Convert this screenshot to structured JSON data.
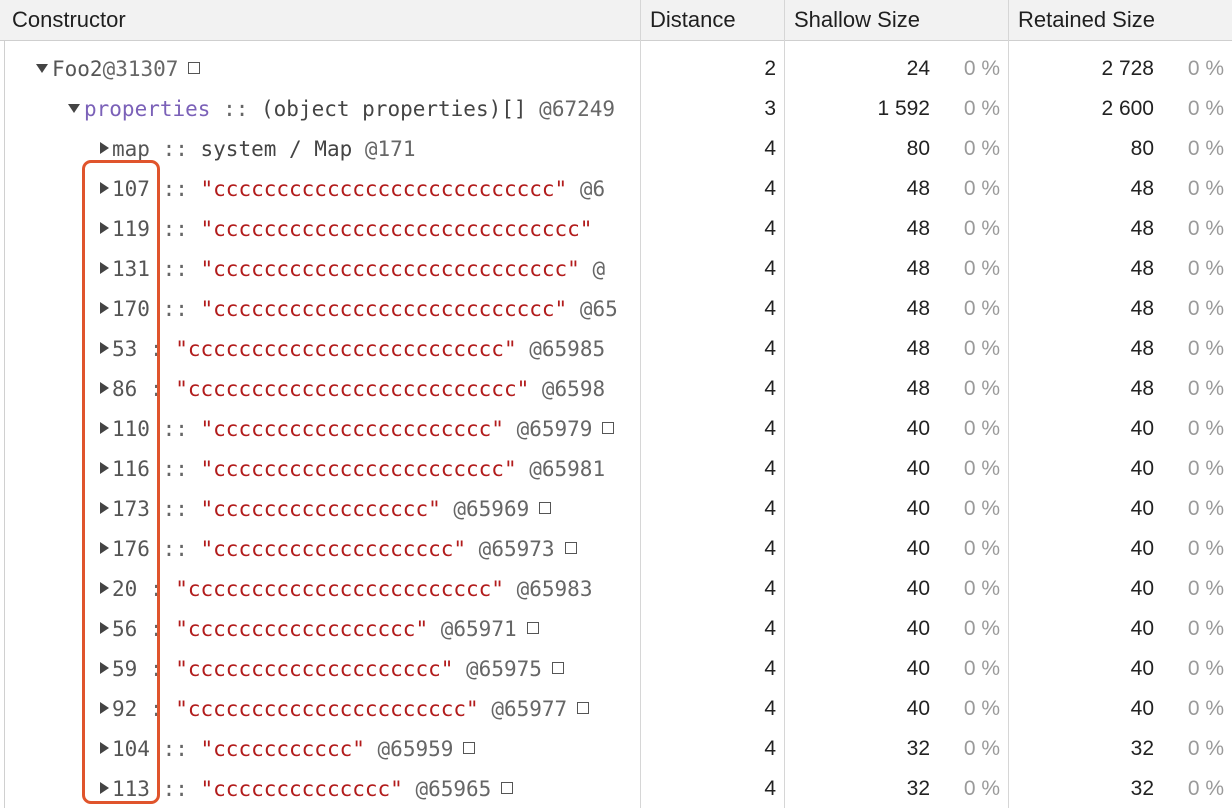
{
  "columns": {
    "constructor": "Constructor",
    "distance": "Distance",
    "shallow": "Shallow Size",
    "retained": "Retained Size"
  },
  "colors": {
    "string": "#b21b1b",
    "highlight": "#e0542c",
    "header_bg": "#f2f2f2"
  },
  "rows": [
    {
      "level": 0,
      "expanded": true,
      "key": "Foo2",
      "sep": "",
      "str": "",
      "type": "",
      "id": "@31307",
      "box": true,
      "distance": "2",
      "shallow": "24",
      "shallow_pct": "0 %",
      "retained": "2 728",
      "retained_pct": "0 %"
    },
    {
      "level": 1,
      "expanded": true,
      "key": "properties",
      "sep": " :: ",
      "str": "",
      "type": "(object properties)[] ",
      "id": "@67249",
      "box": false,
      "distance": "3",
      "shallow": "1 592",
      "shallow_pct": "0 %",
      "retained": "2 600",
      "retained_pct": "0 %"
    },
    {
      "level": 2,
      "expanded": false,
      "key": "map",
      "sep": " :: ",
      "str": "",
      "type": "system / Map ",
      "id": "@171",
      "box": false,
      "distance": "4",
      "shallow": "80",
      "shallow_pct": "0 %",
      "retained": "80",
      "retained_pct": "0 %"
    },
    {
      "level": 2,
      "expanded": false,
      "key": "107",
      "sep": " :: ",
      "str": "\"ccccccccccccccccccccccccccc\"",
      "type": "",
      "id": " @6",
      "box": false,
      "distance": "4",
      "shallow": "48",
      "shallow_pct": "0 %",
      "retained": "48",
      "retained_pct": "0 %"
    },
    {
      "level": 2,
      "expanded": false,
      "key": "119",
      "sep": " :: ",
      "str": "\"ccccccccccccccccccccccccccccc\"",
      "type": "",
      "id": "",
      "box": false,
      "distance": "4",
      "shallow": "48",
      "shallow_pct": "0 %",
      "retained": "48",
      "retained_pct": "0 %"
    },
    {
      "level": 2,
      "expanded": false,
      "key": "131",
      "sep": " :: ",
      "str": "\"cccccccccccccccccccccccccccc\"",
      "type": "",
      "id": " @",
      "box": false,
      "distance": "4",
      "shallow": "48",
      "shallow_pct": "0 %",
      "retained": "48",
      "retained_pct": "0 %"
    },
    {
      "level": 2,
      "expanded": false,
      "key": "170",
      "sep": " :: ",
      "str": "\"ccccccccccccccccccccccccccc\"",
      "type": "",
      "id": " @65",
      "box": false,
      "distance": "4",
      "shallow": "48",
      "shallow_pct": "0 %",
      "retained": "48",
      "retained_pct": "0 %"
    },
    {
      "level": 2,
      "expanded": false,
      "key": "53",
      "sep": "  : ",
      "str": "\"ccccccccccccccccccccccccc\"",
      "type": "",
      "id": " @65985",
      "box": false,
      "distance": "4",
      "shallow": "48",
      "shallow_pct": "0 %",
      "retained": "48",
      "retained_pct": "0 %"
    },
    {
      "level": 2,
      "expanded": false,
      "key": "86",
      "sep": "  : ",
      "str": "\"cccccccccccccccccccccccccc\"",
      "type": "",
      "id": " @6598",
      "box": false,
      "distance": "4",
      "shallow": "48",
      "shallow_pct": "0 %",
      "retained": "48",
      "retained_pct": "0 %"
    },
    {
      "level": 2,
      "expanded": false,
      "key": "110",
      "sep": " :: ",
      "str": "\"cccccccccccccccccccccc\"",
      "type": "",
      "id": " @65979",
      "box": true,
      "distance": "4",
      "shallow": "40",
      "shallow_pct": "0 %",
      "retained": "40",
      "retained_pct": "0 %"
    },
    {
      "level": 2,
      "expanded": false,
      "key": "116",
      "sep": " :: ",
      "str": "\"ccccccccccccccccccccccc\"",
      "type": "",
      "id": " @65981",
      "box": false,
      "distance": "4",
      "shallow": "40",
      "shallow_pct": "0 %",
      "retained": "40",
      "retained_pct": "0 %"
    },
    {
      "level": 2,
      "expanded": false,
      "key": "173",
      "sep": " :: ",
      "str": "\"ccccccccccccccccc\"",
      "type": "",
      "id": " @65969",
      "box": true,
      "distance": "4",
      "shallow": "40",
      "shallow_pct": "0 %",
      "retained": "40",
      "retained_pct": "0 %"
    },
    {
      "level": 2,
      "expanded": false,
      "key": "176",
      "sep": " :: ",
      "str": "\"ccccccccccccccccccc\"",
      "type": "",
      "id": " @65973",
      "box": true,
      "distance": "4",
      "shallow": "40",
      "shallow_pct": "0 %",
      "retained": "40",
      "retained_pct": "0 %"
    },
    {
      "level": 2,
      "expanded": false,
      "key": "20",
      "sep": "  : ",
      "str": "\"cccccccccccccccccccccccc\"",
      "type": "",
      "id": " @65983",
      "box": false,
      "distance": "4",
      "shallow": "40",
      "shallow_pct": "0 %",
      "retained": "40",
      "retained_pct": "0 %"
    },
    {
      "level": 2,
      "expanded": false,
      "key": "56",
      "sep": "  : ",
      "str": "\"cccccccccccccccccc\"",
      "type": "",
      "id": " @65971",
      "box": true,
      "distance": "4",
      "shallow": "40",
      "shallow_pct": "0 %",
      "retained": "40",
      "retained_pct": "0 %"
    },
    {
      "level": 2,
      "expanded": false,
      "key": "59",
      "sep": "  : ",
      "str": "\"cccccccccccccccccccc\"",
      "type": "",
      "id": " @65975",
      "box": true,
      "distance": "4",
      "shallow": "40",
      "shallow_pct": "0 %",
      "retained": "40",
      "retained_pct": "0 %"
    },
    {
      "level": 2,
      "expanded": false,
      "key": "92",
      "sep": "  : ",
      "str": "\"cccccccccccccccccccccc\"",
      "type": "",
      "id": " @65977",
      "box": true,
      "distance": "4",
      "shallow": "40",
      "shallow_pct": "0 %",
      "retained": "40",
      "retained_pct": "0 %"
    },
    {
      "level": 2,
      "expanded": false,
      "key": "104",
      "sep": " :: ",
      "str": "\"ccccccccccc\"",
      "type": "",
      "id": " @65959",
      "box": true,
      "distance": "4",
      "shallow": "32",
      "shallow_pct": "0 %",
      "retained": "32",
      "retained_pct": "0 %"
    },
    {
      "level": 2,
      "expanded": false,
      "key": "113",
      "sep": " :: ",
      "str": "\"cccccccccccccc\"",
      "type": "",
      "id": " @65965",
      "box": true,
      "distance": "4",
      "shallow": "32",
      "shallow_pct": "0 %",
      "retained": "32",
      "retained_pct": "0 %"
    }
  ]
}
